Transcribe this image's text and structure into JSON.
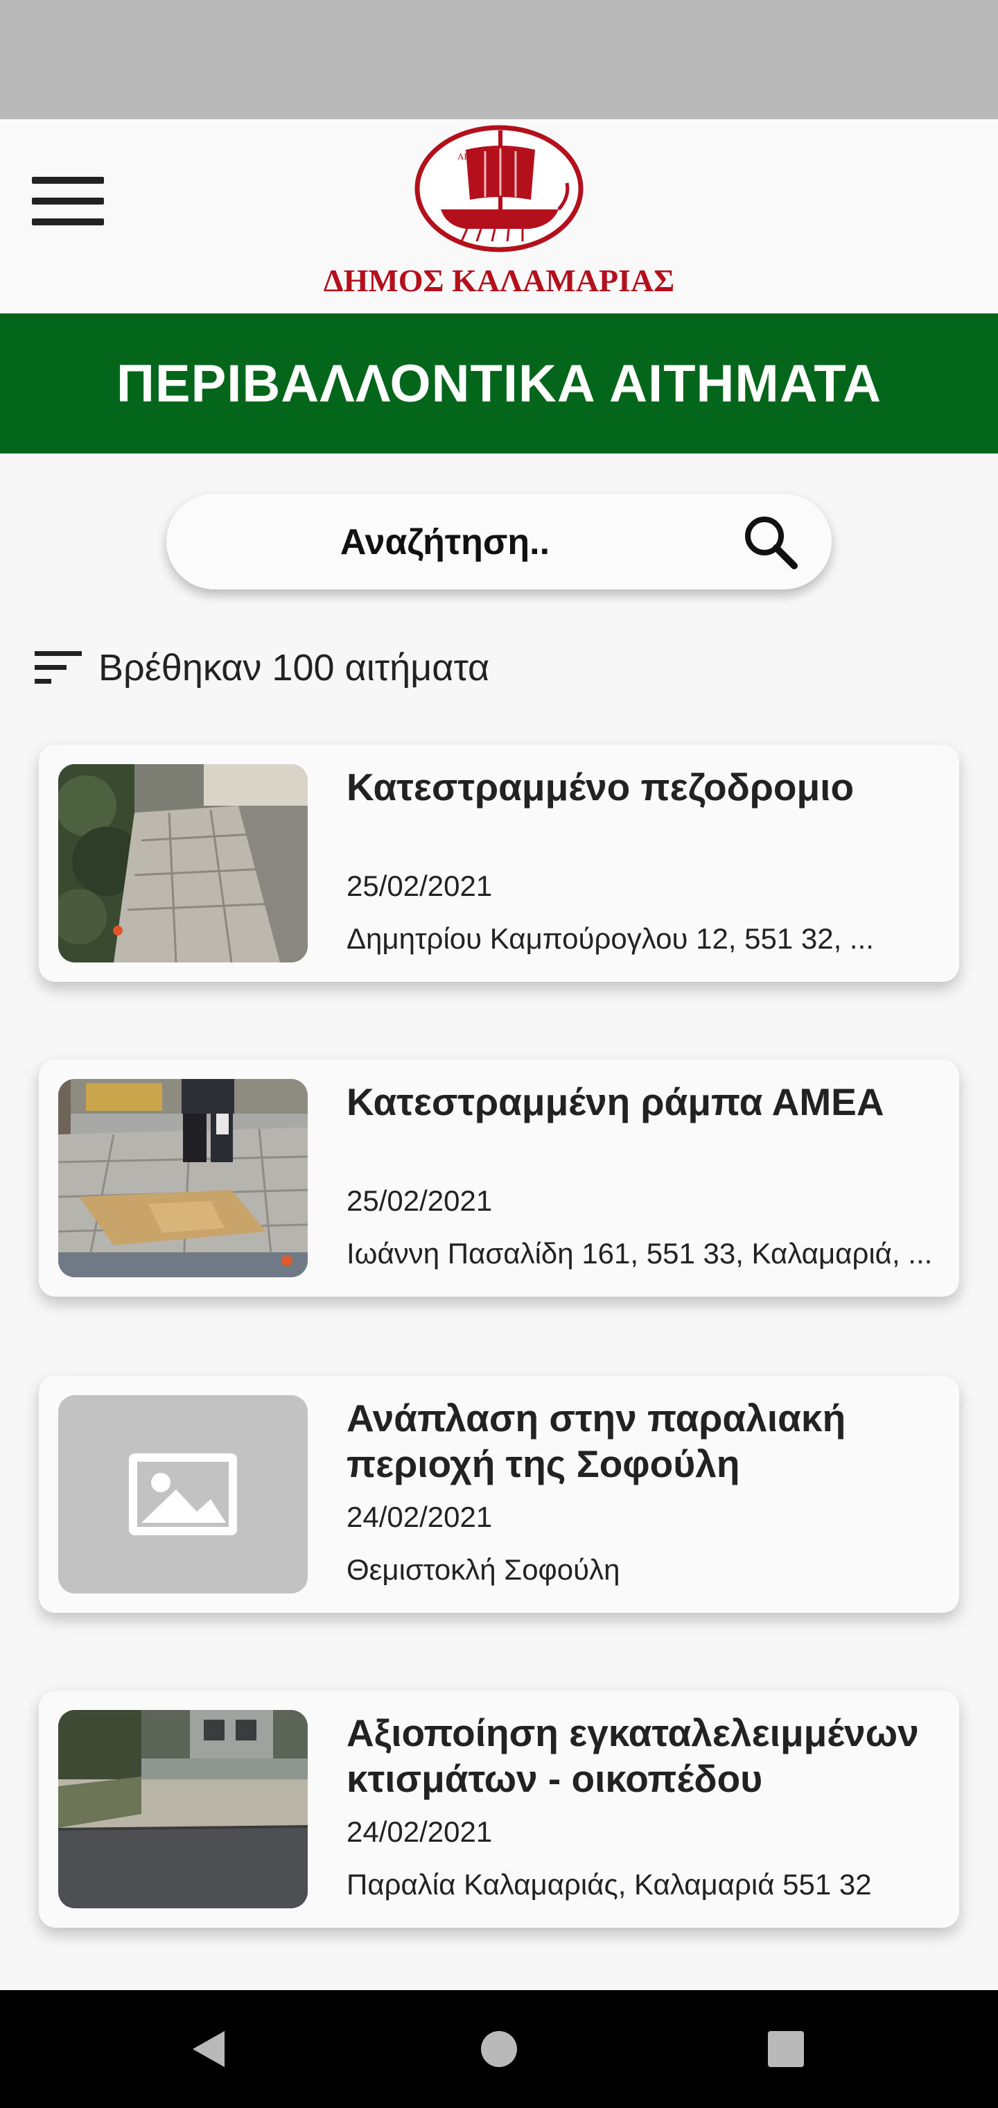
{
  "header": {
    "logo_text": "ΔΗΜΟΣ ΚΑΛΑΜΑΡΙΑΣ",
    "menu_icon": "hamburger-menu-icon"
  },
  "banner": {
    "title": "ΠΕΡΙΒΑΛΛΟΝΤΙΚΑ ΑΙΤΗΜΑΤΑ",
    "color": "#03661b"
  },
  "search": {
    "placeholder": "Αναζήτηση..",
    "icon": "search-icon"
  },
  "results": {
    "icon": "filter-sort-icon",
    "count_text": "Βρέθηκαν 100 αιτήματα"
  },
  "requests": [
    {
      "title": "Κατεστραμμένο πεζοδρομιο",
      "date": "25/02/2021",
      "address": "Δημητρίου Καμπούρογλου 12, 551 32, ..."
    },
    {
      "title": "Κατεστραμμένη ράμπα ΑΜΕΑ",
      "date": "25/02/2021",
      "address": "Ιωάννη Πασαλίδη 161, 551 33, Καλαμαριά, ..."
    },
    {
      "title": "Ανάπλαση στην παραλιακή περιοχή της Σοφούλη",
      "date": "24/02/2021",
      "address": "Θεμιστοκλή Σοφούλη"
    },
    {
      "title": "Αξιοποίηση εγκαταλελειμμένων κτισμάτων - οικοπέδου",
      "date": "24/02/2021",
      "address": "Παραλία Καλαμαριάς, Καλαμαριά 551 32"
    }
  ],
  "navigation": {
    "back_icon": "back-triangle-icon",
    "home_icon": "home-circle-icon",
    "recents_icon": "recents-square-icon"
  }
}
